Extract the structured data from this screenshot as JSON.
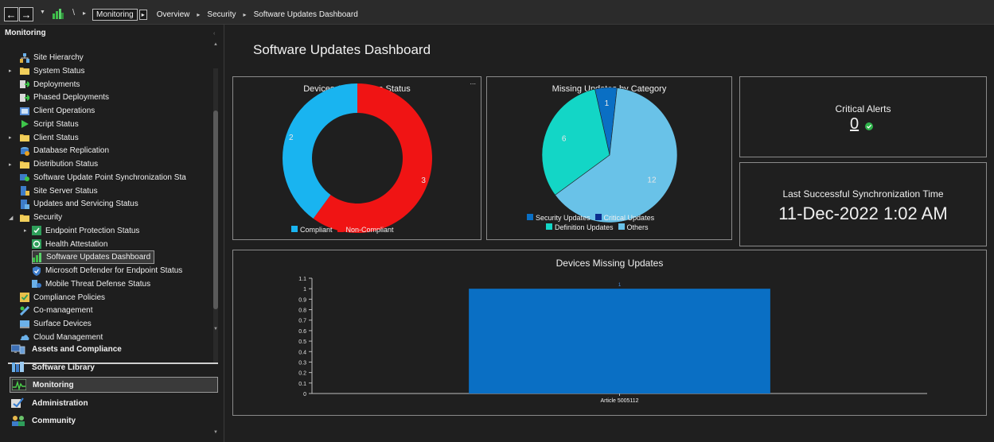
{
  "breadcrumb": {
    "items": [
      "Monitoring",
      "Overview",
      "Security",
      "Software Updates Dashboard"
    ]
  },
  "nav_pane": {
    "header": "Monitoring",
    "items": [
      {
        "label": "Site Hierarchy",
        "icon": "site-hierarchy-icon"
      },
      {
        "label": "System Status",
        "icon": "folder-icon"
      },
      {
        "label": "Deployments",
        "icon": "deployment-icon"
      },
      {
        "label": "Phased Deployments",
        "icon": "deployment-icon"
      },
      {
        "label": "Client Operations",
        "icon": "client-operations-icon"
      },
      {
        "label": "Script Status",
        "icon": "play-icon"
      },
      {
        "label": "Client Status",
        "icon": "folder-icon"
      },
      {
        "label": "Database Replication",
        "icon": "database-icon"
      },
      {
        "label": "Distribution Status",
        "icon": "folder-icon"
      },
      {
        "label": "Software Update Point Synchronization Sta",
        "icon": "sync-icon"
      },
      {
        "label": "Site Server Status",
        "icon": "server-icon"
      },
      {
        "label": "Updates and Servicing Status",
        "icon": "updates-icon"
      },
      {
        "label": "Security",
        "icon": "folder-icon"
      },
      {
        "label": "Endpoint Protection Status",
        "icon": "endpoint-icon"
      },
      {
        "label": "Health Attestation",
        "icon": "health-icon"
      },
      {
        "label": "Software Updates Dashboard",
        "icon": "dashboard-icon"
      },
      {
        "label": "Microsoft Defender for Endpoint Status",
        "icon": "shield-icon"
      },
      {
        "label": "Mobile Threat Defense Status",
        "icon": "mobile-icon"
      },
      {
        "label": "Compliance Policies",
        "icon": "checkbox-icon"
      },
      {
        "label": "Co-management",
        "icon": "co-management-icon"
      },
      {
        "label": "Surface Devices",
        "icon": "surface-icon"
      },
      {
        "label": "Cloud Management",
        "icon": "cloud-icon"
      }
    ]
  },
  "workspaces": [
    {
      "label": "Assets and Compliance"
    },
    {
      "label": "Software Library"
    },
    {
      "label": "Monitoring"
    },
    {
      "label": "Administration"
    },
    {
      "label": "Community"
    }
  ],
  "main": {
    "title": "Software Updates Dashboard",
    "compliance": {
      "title": "Devices Compliance Status",
      "more": "...",
      "legend": [
        "Compliant",
        "Non-Compliant"
      ]
    },
    "missing_by_category": {
      "title": "Missing Updates by Category",
      "legend": [
        "Security Updates",
        "Critical Updates",
        "Definition Updates",
        "Others"
      ]
    },
    "critical_alerts": {
      "title": "Critical Alerts",
      "value": "0"
    },
    "last_sync": {
      "title": "Last Successful Synchronization Time",
      "value": "11-Dec-2022 1:02 AM"
    },
    "devices_missing": {
      "title": "Devices Missing Updates"
    }
  },
  "colors": {
    "compliant": "#19b4f0",
    "non_compliant": "#f01414",
    "security_updates": "#0a6fc4",
    "critical_updates": "#0b2f8f",
    "definition_updates": "#13d6c6",
    "others": "#69c2e8",
    "bar": "#0a6fc4"
  },
  "chart_data": [
    {
      "type": "pie",
      "title": "Devices Compliance Status",
      "categories": [
        "Compliant",
        "Non-Compliant"
      ],
      "values": [
        2,
        3
      ],
      "donut": true
    },
    {
      "type": "pie",
      "title": "Missing Updates by Category",
      "categories": [
        "Security Updates",
        "Critical Updates",
        "Definition Updates",
        "Others"
      ],
      "values": [
        1,
        0,
        6,
        12
      ]
    },
    {
      "type": "bar",
      "title": "Devices Missing Updates",
      "categories": [
        "Article 5005112"
      ],
      "values": [
        1
      ],
      "ylim": [
        0,
        1.1
      ],
      "yticks": [
        "0",
        "0.1",
        "0.2",
        "0.3",
        "0.4",
        "0.5",
        "0.6",
        "0.7",
        "0.8",
        "0.9",
        "1",
        "1.1"
      ]
    }
  ]
}
